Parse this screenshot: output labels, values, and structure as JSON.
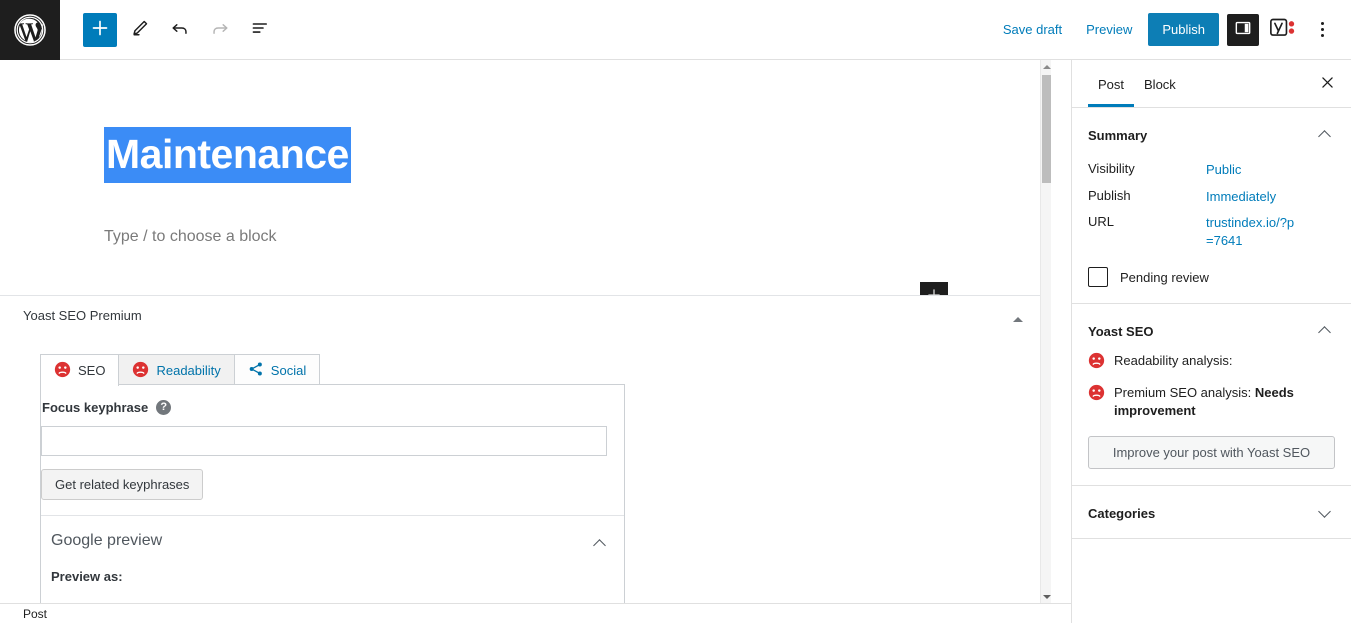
{
  "toolbar": {
    "logo_icon": "wordpress-logo",
    "add_block_label": "+",
    "add_block_icon": "plus-icon",
    "edit_icon": "pencil-icon",
    "undo_icon": "undo-icon",
    "redo_icon": "redo-icon",
    "list_view_icon": "list-view-icon",
    "save_draft_label": "Save draft",
    "preview_label": "Preview",
    "publish_label": "Publish",
    "sidebar_toggle_icon": "settings-sidebar-icon",
    "yoast_icon": "yoast-seo-icon",
    "more_options_icon": "kebab-menu-icon"
  },
  "editor": {
    "post_title": "Maintenance",
    "block_placeholder": "Type / to choose a block",
    "inline_add_icon": "plus-icon",
    "selection_color": "#3b8cf6"
  },
  "metabox": {
    "title": "Yoast SEO Premium",
    "collapse_icon": "triangle-up-icon",
    "tabs": [
      {
        "label": "SEO",
        "icon": "face-bad-icon",
        "active": true
      },
      {
        "label": "Readability",
        "icon": "face-bad-icon",
        "active": false
      },
      {
        "label": "Social",
        "icon": "share-icon",
        "active": false
      }
    ],
    "focus_keyphrase_label": "Focus keyphrase",
    "help_icon": "help-question-icon",
    "focus_keyphrase_value": "",
    "focus_keyphrase_placeholder": "",
    "get_related_label": "Get related keyphrases",
    "google_preview_title": "Google preview",
    "google_preview_toggle_icon": "chevron-up-icon",
    "preview_as_label": "Preview as:"
  },
  "sidebar": {
    "tabs": [
      {
        "label": "Post",
        "active": true
      },
      {
        "label": "Block",
        "active": false
      }
    ],
    "close_icon": "close-icon",
    "summary": {
      "title": "Summary",
      "toggle_icon": "chevron-up-icon",
      "rows": [
        {
          "label": "Visibility",
          "value": "Public"
        },
        {
          "label": "Publish",
          "value": "Immediately"
        },
        {
          "label": "URL",
          "value": "trustindex.io/?p=7641"
        }
      ],
      "pending_review_label": "Pending review",
      "pending_review_checked": false
    },
    "yoast": {
      "title": "Yoast SEO",
      "toggle_icon": "chevron-up-icon",
      "analyses": [
        {
          "icon": "face-bad-icon",
          "text": "Readability analysis:",
          "emphasis": ""
        },
        {
          "icon": "face-bad-icon",
          "text": "Premium SEO analysis: ",
          "emphasis": "Needs improvement"
        }
      ],
      "improve_button_label": "Improve your post with Yoast SEO"
    },
    "categories": {
      "title": "Categories",
      "toggle_icon": "chevron-down-icon"
    }
  },
  "statusbar": {
    "breadcrumb": "Post"
  },
  "colors": {
    "accent_blue": "#007cba",
    "publish_blue": "#0d7eb5",
    "bad_red": "#dc3232",
    "dark": "#1e1e1e"
  }
}
